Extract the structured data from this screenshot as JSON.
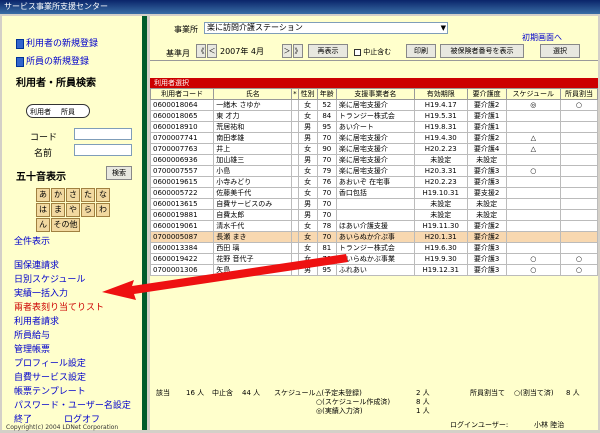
{
  "window": {
    "title": "サービス事業所支援センター"
  },
  "sidebar": {
    "new_user_label": "利用者の新規登録",
    "new_staff_label": "所員の新規登録",
    "search_heading": "利用者・所員検索",
    "radio_user": "利用者",
    "radio_staff": "所員",
    "code_label": "コード",
    "name_label": "名前",
    "kana_heading": "五十音表示",
    "search_button": "検索",
    "kana": [
      "あ",
      "か",
      "さ",
      "た",
      "な",
      "は",
      "ま",
      "や",
      "ら",
      "わ"
    ],
    "kana_n": "ん",
    "kana_other": "その他",
    "all_label": "全件表示",
    "menu": [
      "国保連請求",
      "日別スケジュール",
      "実績一括入力",
      "兩者表刻り当てりスト",
      "利用者請求",
      "所員給与",
      "管理帳票",
      "プロフィール設定",
      "自費サービス設定",
      "帳票テンプレート",
      "パスワード・ユーザー名設定",
      "終了"
    ],
    "logout_label": "ログオフ",
    "copyright": "Copyright(c) 2004 LDNet Corporation"
  },
  "toolbar": {
    "office_label": "事業所",
    "office_value": "楽に訪問介護ステーション",
    "initial_screen": "初期画面へ",
    "base_month_label": "基準月",
    "prev_prev": "《",
    "prev": "＜",
    "month_value": "2007年 4月",
    "next": "＞",
    "next_next": "》",
    "display_button": "再表示",
    "include_stopped": "中止含む",
    "print_button": "印刷",
    "unregistered_button": "被保険者番号を表示",
    "select_button": "選択"
  },
  "table": {
    "title": "利用者選択",
    "headers": [
      "利用者コード",
      "氏名",
      "*",
      "性別",
      "年齢",
      "支援事業者名",
      "有効期限",
      "要介護度",
      "スケジュール",
      "所員割当"
    ],
    "rows": [
      [
        "0600018064",
        "一緒木 さゆか",
        "",
        "女",
        "52",
        "楽に居宅支援介",
        "H19.4.17",
        "要介護2",
        "◎",
        "○"
      ],
      [
        "0600018065",
        "東 才力",
        "",
        "女",
        "84",
        "トランジー株式会",
        "H19.5.31",
        "要介護1",
        "",
        ""
      ],
      [
        "0600018910",
        "荒居祐和",
        "",
        "男",
        "95",
        "あい介ート",
        "H19.8.31",
        "要介護1",
        "",
        ""
      ],
      [
        "0700007741",
        "南田孝雄",
        "",
        "男",
        "70",
        "楽に居宅支援介",
        "H19.4.30",
        "要介護2",
        "△",
        ""
      ],
      [
        "0700007763",
        "井上",
        "",
        "女",
        "90",
        "楽に居宅支援介",
        "H20.2.23",
        "要介護4",
        "△",
        ""
      ],
      [
        "0600006936",
        "加山雄三",
        "",
        "男",
        "70",
        "楽に居宅支援介",
        "未設定",
        "未設定",
        "",
        ""
      ],
      [
        "0700007557",
        "小島",
        "",
        "女",
        "79",
        "楽に居宅支援介",
        "H20.3.31",
        "要介護3",
        "○",
        ""
      ],
      [
        "0600019615",
        "小寺みどり",
        "",
        "女",
        "76",
        "あおいぞ 在宅事",
        "H20.2.23",
        "要介護3",
        "",
        ""
      ],
      [
        "0600005722",
        "佐藤美千代",
        "",
        "女",
        "70",
        "香口包括",
        "H19.10.31",
        "要支援2",
        "",
        ""
      ],
      [
        "0600013615",
        "自費サービスのみ",
        "",
        "男",
        "70",
        "",
        "未設定",
        "未設定",
        "",
        ""
      ],
      [
        "0600019881",
        "自費太郎",
        "",
        "男",
        "70",
        "",
        "未設定",
        "未設定",
        "",
        ""
      ],
      [
        "0600019061",
        "清水千代",
        "",
        "女",
        "78",
        "ほあい介護支援",
        "H19.11.30",
        "要介護2",
        "",
        ""
      ],
      [
        "0700005087",
        "長瀬 まき",
        "",
        "女",
        "70",
        "あいらぬか介ぷ事",
        "H20.1.31",
        "要介護2",
        "",
        ""
      ],
      [
        "0600013384",
        "西田 璃",
        "",
        "女",
        "81",
        "トランジー株式会",
        "H19.6.30",
        "要介護3",
        "",
        ""
      ],
      [
        "0600019422",
        "花野 音代子",
        "",
        "女",
        "70",
        "あいらぬかぶ事業",
        "H19.9.30",
        "要介護3",
        "○",
        "○"
      ],
      [
        "0700001306",
        "矢島",
        "",
        "男",
        "95",
        "ふれあい",
        "H19.12.31",
        "要介護3",
        "○",
        "○"
      ]
    ],
    "highlight_row": 12
  },
  "summary": {
    "total_label": "該当",
    "total_value": "16 人",
    "stopped_label": "中止含",
    "stopped_value": "44 人",
    "schedule_label": "スケジュール",
    "sched_1": "△(予定未登録)",
    "sched_1_value": "2 人",
    "sched_2": "○(スケジュール作成済)",
    "sched_2_value": "8 人",
    "sched_3": "◎(実績入力済)",
    "sched_3_value": "1 人",
    "staff_label": "所員割当て",
    "staff_assigned": "○(割当て済)",
    "staff_value": "8 人",
    "login_label": "ログインユーザー:",
    "login_user": "小林 陸治"
  },
  "colors": {
    "sidebar_bg": "#ffffcc",
    "sidebar_border": "#005c2b",
    "table_title_bg": "#cc0000",
    "highlight_row": "#f8d8b0",
    "arrow": "#ee1111"
  }
}
